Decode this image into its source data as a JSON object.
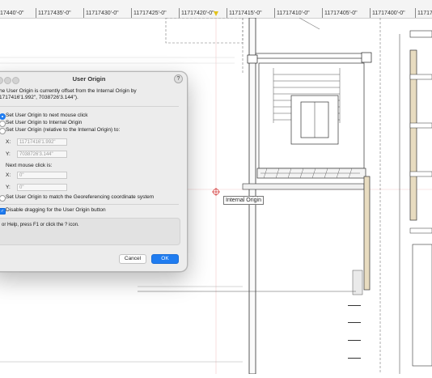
{
  "ruler": {
    "labels": [
      "17440'-0\"",
      "11717435'-0\"",
      "11717430'-0\"",
      "11717425'-0\"",
      "11717420'-0\"",
      "11717415'-0\"",
      "11717410'-0\"",
      "11717405'-0\"",
      "11717400'-0\"",
      "1171739"
    ]
  },
  "drawing": {
    "origin_label": "Internal Origin"
  },
  "dialog": {
    "title": "User Origin",
    "help_icon": "?",
    "info_line1": "he User Origin is currently offset from the Internal Origin by",
    "info_line2": "1717416'1.992\", 7038726'3.144\").",
    "opt_next_click": "Set User Origin to next mouse click",
    "opt_internal": "Set User Origin to Internal Origin",
    "opt_relative": "Set User Origin (relative to the Internal Origin) to:",
    "x_label": "X:",
    "y_label": "Y:",
    "x_value": "11717416'1.992\"",
    "y_value": "7038726'3.144\"",
    "next_click_label": "Next mouse click is:",
    "x2_label": "X:",
    "y2_label": "Y:",
    "x2_value": "0\"",
    "y2_value": "0\"",
    "opt_georef": "Set User Origin to match the Georeferencing coordinate system",
    "disable_drag": "Disable dragging for the User Origin button",
    "help_text": "or Help, press F1 or click the ? icon.",
    "cancel": "Cancel",
    "ok": "OK"
  },
  "colors": {
    "accent": "#1f7cf0",
    "ruler_marker": "#e3c21a",
    "wall_fill": "#e8dcc0"
  }
}
